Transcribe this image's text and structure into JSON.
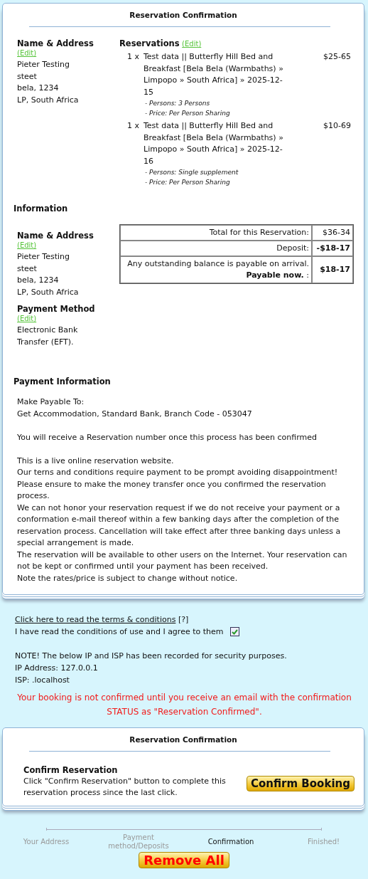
{
  "main_panel": {
    "title": "Reservation Confirmation",
    "guest": {
      "heading": "Name & Address",
      "edit": "(Edit)",
      "lines": [
        "Pieter Testing",
        "steet",
        "bela, 1234",
        "LP, South Africa"
      ]
    },
    "reservations": {
      "heading": "Reservations",
      "edit": "(Edit)",
      "items": [
        {
          "qty": "1 x",
          "description": "Test data || Butterfly Hill Bed and Breakfast [Bela Bela (Warmbaths) » Limpopo » South Africa] » 2025-12-15",
          "price": "$25-65",
          "details": [
            "- Persons: 3 Persons",
            "- Price: Per Person Sharing"
          ]
        },
        {
          "qty": "1 x",
          "description": "Test data || Butterfly Hill Bed and Breakfast [Bela Bela (Warmbaths) » Limpopo » South Africa] » 2025-12-16",
          "price": "$10-69",
          "details": [
            "- Persons: Single supplement",
            "- Price: Per Person Sharing"
          ]
        }
      ]
    },
    "information": {
      "heading": "Information",
      "name_address": {
        "heading": "Name & Address",
        "edit": "(Edit)",
        "lines": [
          "Pieter Testing",
          "steet",
          "bela, 1234",
          "LP, South Africa"
        ]
      },
      "payment_method": {
        "heading": "Payment Method",
        "edit": "(Edit)",
        "lines": [
          "Electronic Bank Transfer (EFT)."
        ]
      },
      "totals": [
        {
          "label": "Total for this Reservation:",
          "value": "$36-34",
          "bold": false
        },
        {
          "label": "Deposit:",
          "value": "-$18-17",
          "bold": true
        },
        {
          "label": "Any outstanding balance is payable on arrival. **Payable now.** :",
          "value": "$18-17",
          "bold": true
        }
      ]
    },
    "payment_information": {
      "heading": "Payment Information",
      "blocks": [
        [
          "Make Payable To:",
          "Get Accommodation, Standard Bank, Branch Code - 053047"
        ],
        [
          "You will receive a Reservation number once this process has been confirmed"
        ],
        [
          "This is a live online reservation website.",
          "Our terns and conditions require payment to be prompt avoiding disappointment!",
          "Please ensure to make the money transfer once you confirmed the reservation process.",
          "We can not honor your reservation request if we do not receive your payment or a conformation e-mail thereof within a few banking days after the completion of the reservation process. Cancellation will take effect after three banking days unless a special arrangement is made.",
          "The reservation will be available to other users on the Internet. Your reservation can not be kept or confirmed until your payment has been received.",
          "Note the rates/price is subject to change without notice."
        ]
      ]
    }
  },
  "terms": {
    "link": "Click here to read the terms & conditions",
    "help": "[?]",
    "agree_label": "I have read the conditions of use and I agree to them",
    "checked": true
  },
  "security": [
    "NOTE! The below IP and ISP has been recorded for security purposes.",
    "IP Address: 127.0.0.1",
    "ISP: .localhost"
  ],
  "warning": "Your booking is not confirmed until you receive an email with the confirmation STATUS as \"Reservation Confirmed\".",
  "confirm_panel": {
    "title": "Reservation Confirmation",
    "heading": "Confirm Reservation",
    "text": "Click \"Confirm Reservation\" button to complete this reservation process since the last click.",
    "button": "Confirm Booking"
  },
  "steps": [
    {
      "label": "Your Address",
      "selected": false
    },
    {
      "label": "Payment method/Deposits",
      "selected": false
    },
    {
      "label": "Confirmation",
      "selected": true
    },
    {
      "label": "Finished!",
      "selected": false
    }
  ],
  "remove_button": "Remove All"
}
